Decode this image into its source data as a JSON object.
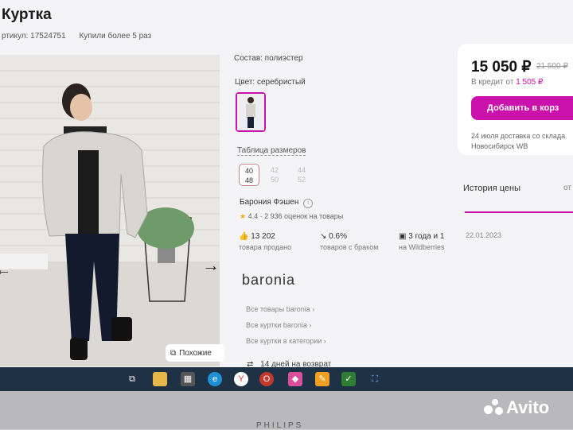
{
  "product": {
    "title": "Куртка",
    "article": "ртикул: 17524751",
    "bought": "Купили более 5 раз",
    "composition": "Состав: полиэстер",
    "color": "Цвет: серебристый",
    "size_table_link": "Таблица размеров",
    "sizes": [
      {
        "top": "40",
        "bottom": "48"
      },
      {
        "top": "42",
        "bottom": "50"
      },
      {
        "top": "44",
        "bottom": "52"
      }
    ],
    "similar_label": "Похожие"
  },
  "seller": {
    "name": "Барония Фэшен",
    "rating": "4.4",
    "reviews": "2 936 оценок на товары",
    "stats": [
      {
        "value": "13 202",
        "label": "товара продано"
      },
      {
        "value": "0.6%",
        "label": "товаров с браком"
      },
      {
        "value": "3 года и 1",
        "label": "на Wildberries"
      }
    ],
    "logo_text": "baronia",
    "links": [
      "Все товары baronia",
      "Все куртки baronia",
      "Все куртки в категории"
    ],
    "return_text": "14 дней на возврат"
  },
  "price_card": {
    "price": "15 050 ₽",
    "old_price": "21 500 ₽",
    "credit_label": "В кредит от",
    "credit_value": "1 505 ₽",
    "add_button": "Добавить в корз",
    "delivery_line1": "24 июля доставка со склада",
    "delivery_line2": "Новосибирск WB"
  },
  "history": {
    "title": "История цены",
    "tab_cut": "от",
    "date": "22.01.2023"
  },
  "accent_color": "#cb11ab",
  "monitor_brand": "PHILIPS",
  "watermark": "Avito"
}
